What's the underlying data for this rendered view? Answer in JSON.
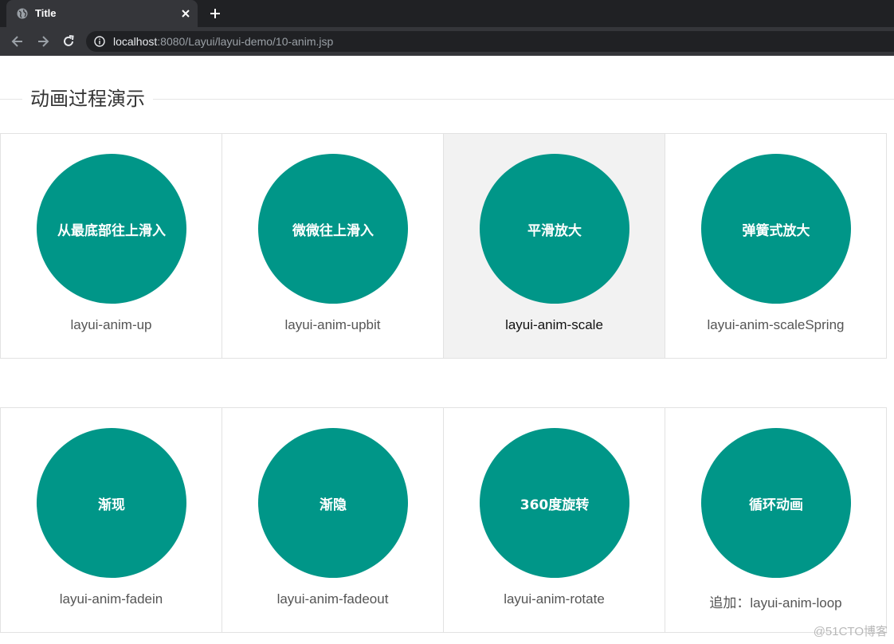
{
  "browser": {
    "tab_title": "Title",
    "url_host": "localhost",
    "url_rest": ":8080/Layui/layui-demo/10-anim.jsp"
  },
  "page": {
    "legend": "动画过程演示",
    "rows": [
      {
        "cells": [
          {
            "circle_text": "从最底部往上滑入",
            "label": "layui-anim-up"
          },
          {
            "circle_text": "微微往上滑入",
            "label": "layui-anim-upbit"
          },
          {
            "circle_text": "平滑放大",
            "label": "layui-anim-scale"
          },
          {
            "circle_text": "弹簧式放大",
            "label": "layui-anim-scaleSpring"
          }
        ]
      },
      {
        "cells": [
          {
            "circle_text": "渐现",
            "label": "layui-anim-fadein"
          },
          {
            "circle_text": "渐隐",
            "label": "layui-anim-fadeout"
          },
          {
            "circle_text": "360度旋转",
            "label": "layui-anim-rotate"
          },
          {
            "circle_text": "循环动画",
            "label": "追加：layui-anim-loop"
          }
        ]
      }
    ],
    "watermark": "@51CTO博客"
  },
  "colors": {
    "accent": "#009688",
    "hover_cell": "#f2f2f2",
    "border": "#e2e2e2"
  }
}
